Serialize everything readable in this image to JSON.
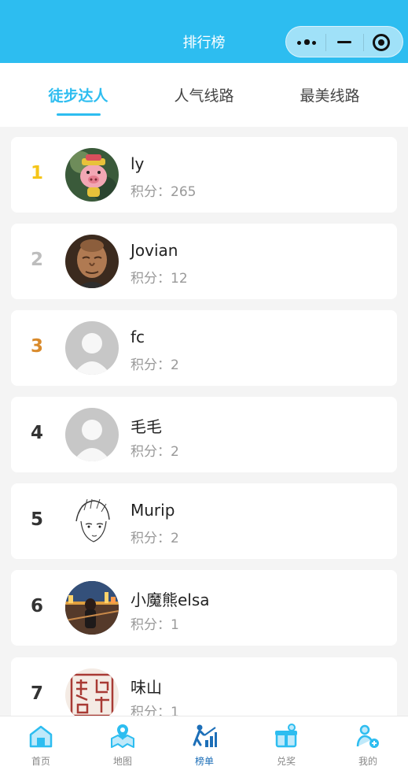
{
  "header": {
    "title": "排行榜"
  },
  "tabs": [
    {
      "label": "徒步达人",
      "active": true
    },
    {
      "label": "人气线路",
      "active": false
    },
    {
      "label": "最美线路",
      "active": false
    }
  ],
  "score_prefix": "积分：",
  "ranking": [
    {
      "rank": "1",
      "name": "ly",
      "score": "265",
      "avatar": "pig-cartoon-avatar"
    },
    {
      "rank": "2",
      "name": "Jovian",
      "score": "12",
      "avatar": "elderly-man-avatar"
    },
    {
      "rank": "3",
      "name": "fc",
      "score": "2",
      "avatar": "default-avatar"
    },
    {
      "rank": "4",
      "name": "毛毛",
      "score": "2",
      "avatar": "default-avatar"
    },
    {
      "rank": "5",
      "name": "Murip",
      "score": "2",
      "avatar": "sketch-boy-avatar"
    },
    {
      "rank": "6",
      "name": "小魔熊elsa",
      "score": "1",
      "avatar": "night-city-avatar"
    },
    {
      "rank": "7",
      "name": "味山",
      "score": "1",
      "avatar": "seal-stamp-avatar"
    }
  ],
  "tabbar": [
    {
      "label": "首页",
      "icon": "home-icon",
      "active": false
    },
    {
      "label": "地图",
      "icon": "map-icon",
      "active": false
    },
    {
      "label": "榜单",
      "icon": "ranking-icon",
      "active": true
    },
    {
      "label": "兑奖",
      "icon": "gift-icon",
      "active": false
    },
    {
      "label": "我的",
      "icon": "profile-icon",
      "active": false
    }
  ],
  "colors": {
    "primary": "#2dbdf0",
    "gold": "#f5c518",
    "silver": "#bdbdbd",
    "bronze": "#d98a2b",
    "nav_active": "#1d6fb8"
  }
}
